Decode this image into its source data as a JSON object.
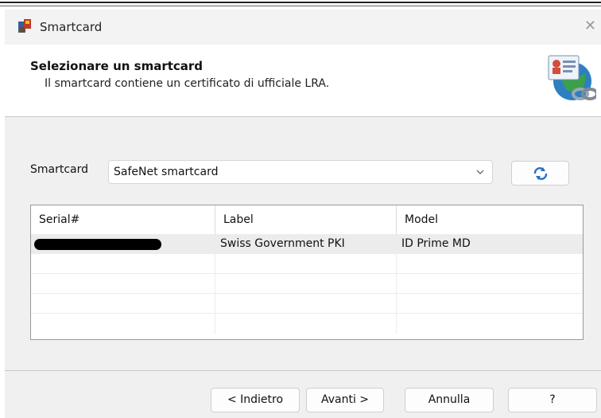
{
  "window": {
    "title": "Smartcard"
  },
  "header": {
    "title": "Selezionare un smartcard",
    "subtitle": "Il smartcard contiene un certificato di ufficiale LRA."
  },
  "smartcard": {
    "label": "Smartcard",
    "selected": "SafeNet smartcard"
  },
  "table": {
    "columns": [
      "Serial#",
      "Label",
      "Model"
    ],
    "rows": [
      {
        "serial": "",
        "label": "Swiss Government PKI",
        "model": "ID Prime MD"
      }
    ]
  },
  "buttons": {
    "back": "< Indietro",
    "next": "Avanti >",
    "cancel": "Annulla",
    "help": "?"
  },
  "icons": {
    "app": "smartcard-app-icon",
    "close": "close-icon",
    "header": "certificate-chain-icon",
    "dropdown": "chevron-down-icon",
    "refresh": "refresh-icon"
  }
}
